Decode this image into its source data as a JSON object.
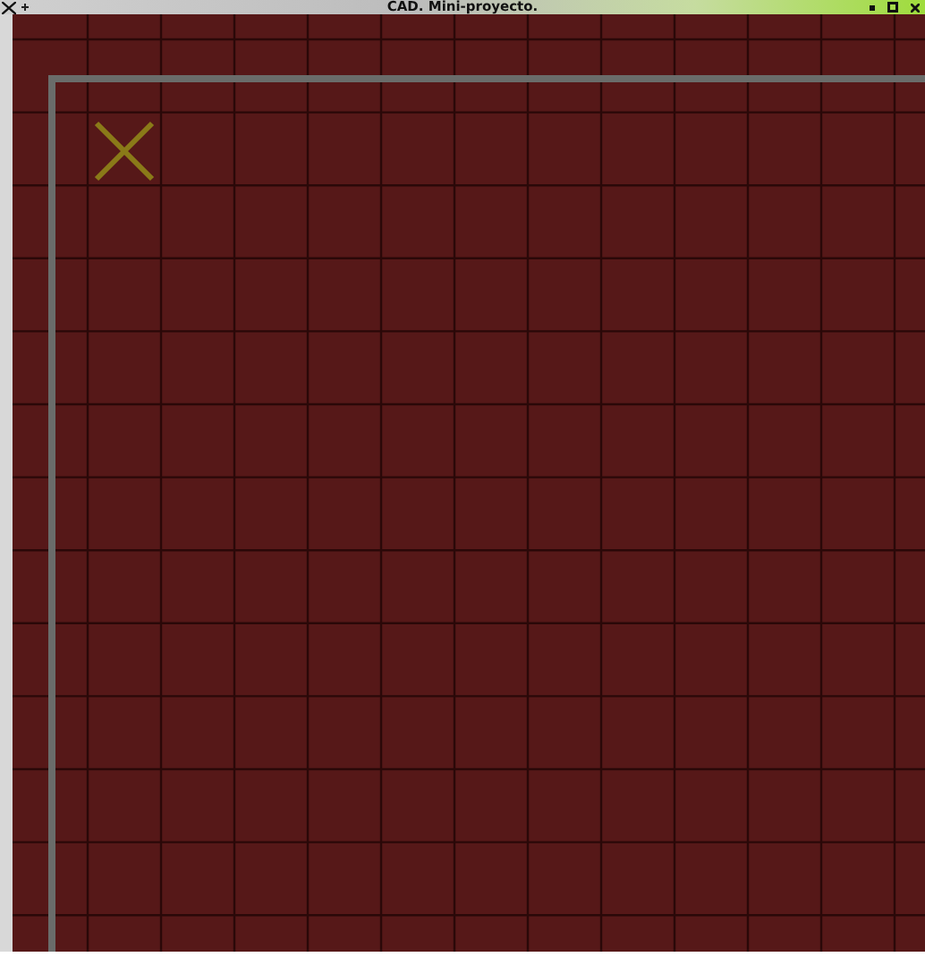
{
  "window": {
    "title": "CAD. Mini-proyecto."
  }
}
